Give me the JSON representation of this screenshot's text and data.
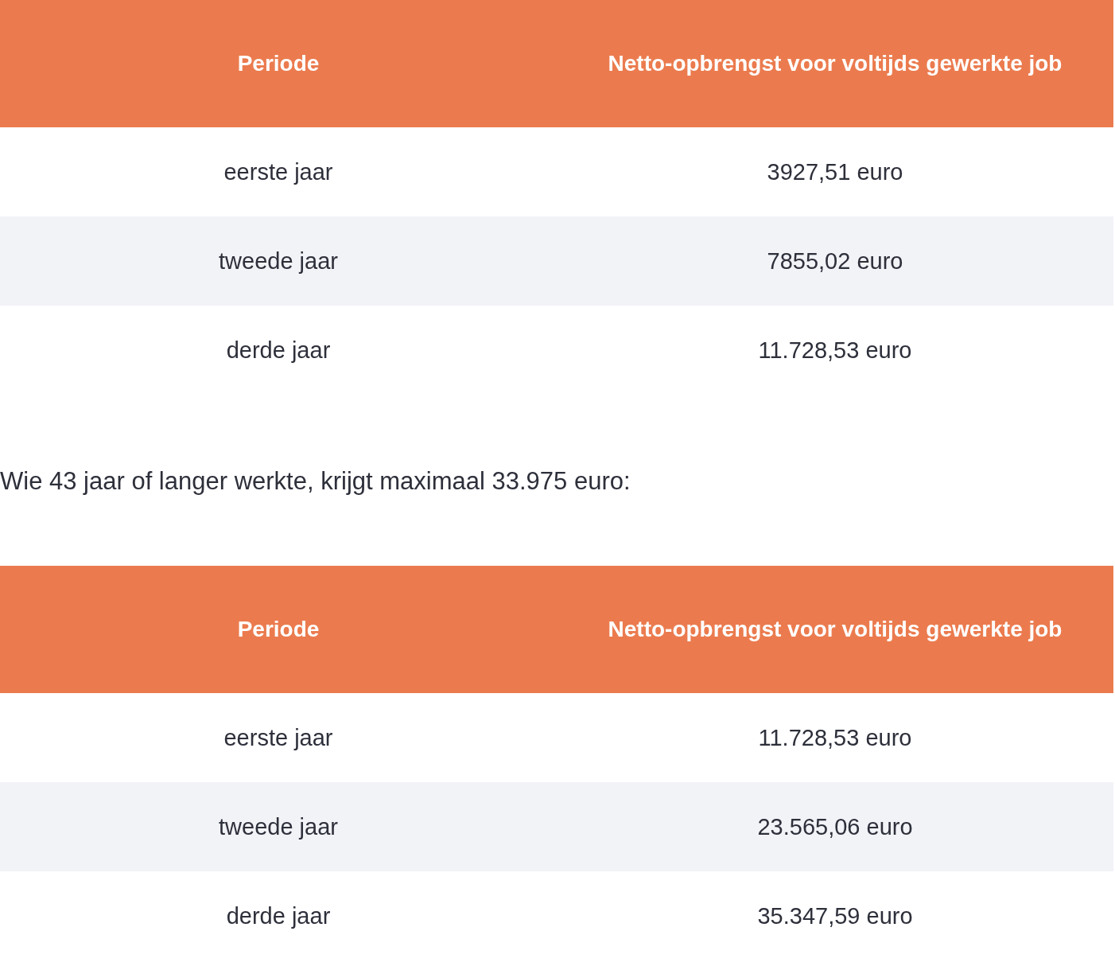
{
  "tables": [
    {
      "columns": [
        "Periode",
        "Netto-opbrengst voor voltijds gewerkte job"
      ],
      "rows": [
        [
          "eerste jaar",
          "3927,51 euro"
        ],
        [
          "tweede jaar",
          "7855,02 euro"
        ],
        [
          "derde jaar",
          "11.728,53 euro"
        ]
      ]
    },
    {
      "intro": "Wie 43 jaar of langer werkte, krijgt maximaal 33.975 euro:",
      "columns": [
        "Periode",
        "Netto-opbrengst voor voltijds gewerkte job"
      ],
      "rows": [
        [
          "eerste jaar",
          "11.728,53 euro"
        ],
        [
          "tweede jaar",
          "23.565,06 euro"
        ],
        [
          "derde jaar",
          "35.347,59 euro"
        ]
      ]
    }
  ]
}
